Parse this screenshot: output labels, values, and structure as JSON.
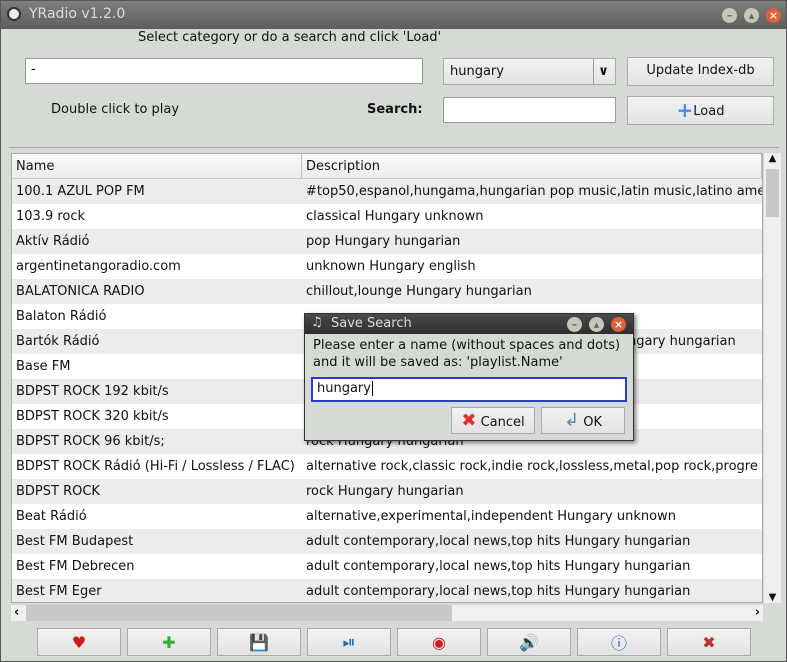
{
  "window": {
    "title": "YRadio v1.2.0"
  },
  "top": {
    "instruction": "Select category or do a search and click 'Load'",
    "category_value": "-",
    "country_select": "hungary",
    "update_button": "Update Index-db",
    "hint": "Double click to play",
    "search_label": "Search:",
    "search_value": "",
    "load_button": "Load"
  },
  "table": {
    "columns": [
      "Name",
      "Description"
    ],
    "rows": [
      {
        "name": "100.1 AZUL POP FM",
        "desc": "#top50,espanol,hungama,hungarian pop music,latin music,latino ame"
      },
      {
        "name": "103.9 rock",
        "desc": "classical Hungary unknown"
      },
      {
        "name": "Aktív Rádió",
        "desc": "pop Hungary hungarian"
      },
      {
        "name": "argentinetangoradio.com",
        "desc": "unknown Hungary english"
      },
      {
        "name": "BALATONICA RADIO",
        "desc": "chillout,lounge Hungary hungarian"
      },
      {
        "name": "Balaton Rádió",
        "desc": ""
      },
      {
        "name": "Bartók Rádió",
        "desc": "ngary hungarian"
      },
      {
        "name": "Base FM",
        "desc": ""
      },
      {
        "name": "BDPST ROCK  192 kbit/s",
        "desc": ""
      },
      {
        "name": "BDPST ROCK  320 kbit/s",
        "desc": ""
      },
      {
        "name": "BDPST ROCK  96 kbit/s;",
        "desc": "rock Hungary hungarian"
      },
      {
        "name": "BDPST ROCK Rádió (Hi-Fi / Lossless / FLAC)",
        "desc": "alternative rock,classic rock,indie rock,lossless,metal,pop rock,progre"
      },
      {
        "name": "BDPST ROCK",
        "desc": "rock Hungary hungarian"
      },
      {
        "name": "Beat Rádió",
        "desc": "alternative,experimental,independent Hungary unknown"
      },
      {
        "name": "Best FM Budapest",
        "desc": "adult contemporary,local news,top hits Hungary hungarian"
      },
      {
        "name": "Best FM Debrecen",
        "desc": "adult contemporary,local news,top hits Hungary hungarian"
      },
      {
        "name": "Best FM Eger",
        "desc": "adult contemporary,local news,top hits Hungary hungarian"
      }
    ]
  },
  "toolbar": [
    {
      "icon": "heart-icon"
    },
    {
      "icon": "add-icon"
    },
    {
      "icon": "save-icon"
    },
    {
      "icon": "play-pause-icon"
    },
    {
      "icon": "record-icon"
    },
    {
      "icon": "volume-icon"
    },
    {
      "icon": "info-icon"
    },
    {
      "icon": "exit-icon"
    }
  ],
  "dialog": {
    "title": "Save Search",
    "message_line1": "Please enter a name (without spaces and dots)",
    "message_line2": "and it will be saved as: 'playlist.Name'",
    "value": "hungary",
    "cancel": "Cancel",
    "ok": "OK"
  }
}
